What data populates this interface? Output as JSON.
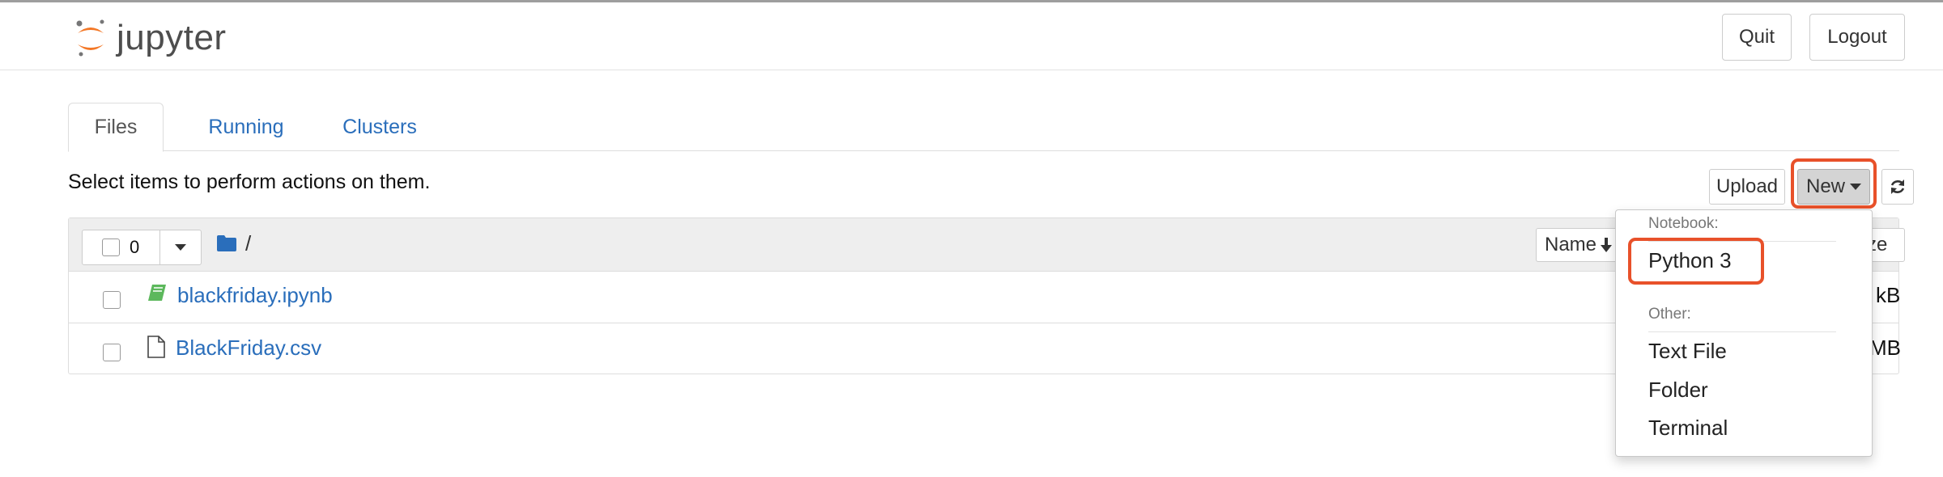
{
  "app": {
    "logo_text": "jupyter"
  },
  "header": {
    "quit_label": "Quit",
    "logout_label": "Logout"
  },
  "tabs": [
    {
      "label": "Files",
      "active": true
    },
    {
      "label": "Running",
      "active": false
    },
    {
      "label": "Clusters",
      "active": false
    }
  ],
  "toolbar": {
    "hint": "Select items to perform actions on them.",
    "upload_label": "Upload",
    "new_label": "New"
  },
  "list": {
    "selected_count": "0",
    "breadcrumb": "/",
    "sort_name_label": "Name",
    "sort_name_icon": "arrow-down",
    "size_header_partial": "ze",
    "files": [
      {
        "name": "blackfriday.ipynb",
        "type": "notebook",
        "size_partial": "kB"
      },
      {
        "name": "BlackFriday.csv",
        "type": "file",
        "size_partial": "MB"
      }
    ]
  },
  "new_menu": {
    "notebook_header": "Notebook:",
    "notebook_items": [
      "Python 3"
    ],
    "other_header": "Other:",
    "other_items": [
      "Text File",
      "Folder",
      "Terminal"
    ]
  },
  "colors": {
    "link": "#2a6ebb",
    "highlight": "#e8512a",
    "logo_orange": "#f37726"
  }
}
